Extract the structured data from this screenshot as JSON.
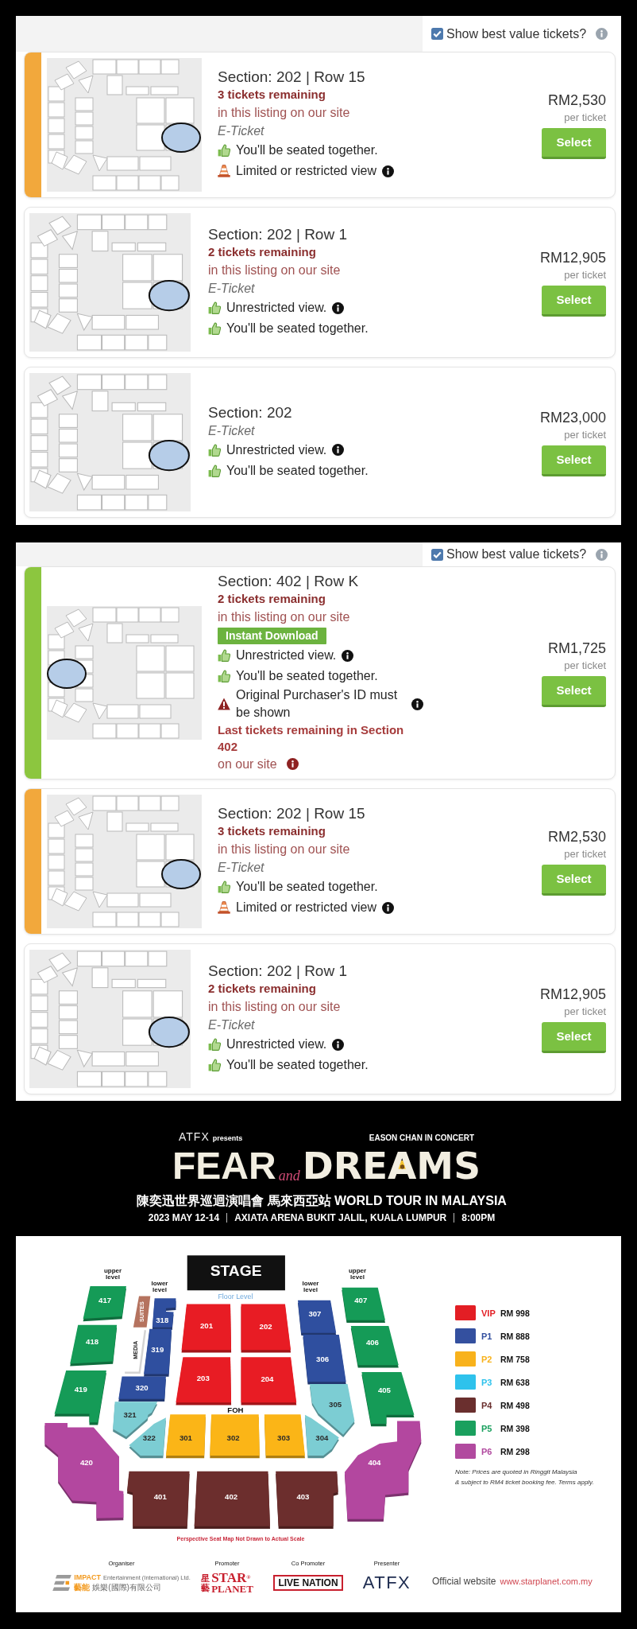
{
  "panels": [
    {
      "filter": {
        "label": "Show best value tickets?",
        "checked": true,
        "info": true
      },
      "listings": [
        {
          "color": "#f2a83c",
          "highlight_left": false,
          "title": "Section: 202 | Row 15",
          "remaining": "3 tickets remaining",
          "availability": "in this listing on our site",
          "delivery": "E-Ticket",
          "features": [
            {
              "kind": "thumb",
              "text": "You'll be seated together.",
              "info": false
            },
            {
              "kind": "cone",
              "text": "Limited or restricted view",
              "info": true
            }
          ],
          "price": "RM2,530",
          "price_unit": "per ticket",
          "button": "Select"
        },
        {
          "highlight_left": false,
          "title": "Section: 202 | Row 1",
          "remaining": "2 tickets remaining",
          "availability": "in this listing on our site",
          "delivery": "E-Ticket",
          "features": [
            {
              "kind": "thumb",
              "text": "Unrestricted view.",
              "info": true
            },
            {
              "kind": "thumb",
              "text": "You'll be seated together.",
              "info": false
            }
          ],
          "price": "RM12,905",
          "price_unit": "per ticket",
          "button": "Select"
        },
        {
          "highlight_left": false,
          "title": "Section: 202",
          "delivery": "E-Ticket",
          "features": [
            {
              "kind": "thumb",
              "text": "Unrestricted view.",
              "info": true
            },
            {
              "kind": "thumb",
              "text": "You'll be seated together.",
              "info": false
            }
          ],
          "price": "RM23,000",
          "price_unit": "per ticket",
          "button": "Select"
        }
      ]
    },
    {
      "filter": {
        "label": "Show best value tickets?",
        "checked": true,
        "info": true
      },
      "listings": [
        {
          "color": "#8cc63f",
          "highlight_left": true,
          "title": "Section: 402 | Row K",
          "remaining": "2 tickets remaining",
          "availability": "in this listing on our site",
          "badge": "Instant Download",
          "features": [
            {
              "kind": "thumb",
              "text": "Unrestricted view.",
              "info": true
            },
            {
              "kind": "thumb",
              "text": "You'll be seated together.",
              "info": false
            },
            {
              "kind": "warning",
              "text": "Original Purchaser's ID must be shown",
              "info": true
            }
          ],
          "notice": {
            "text": "Last tickets remaining in Section 402",
            "detail": "on our site",
            "info": true
          },
          "price": "RM1,725",
          "price_unit": "per ticket",
          "button": "Select"
        },
        {
          "color": "#f2a83c",
          "highlight_left": false,
          "title": "Section: 202 | Row 15",
          "remaining": "3 tickets remaining",
          "availability": "in this listing on our site",
          "delivery": "E-Ticket",
          "features": [
            {
              "kind": "thumb",
              "text": "You'll be seated together.",
              "info": false
            },
            {
              "kind": "cone",
              "text": "Limited or restricted view",
              "info": true
            }
          ],
          "price": "RM2,530",
          "price_unit": "per ticket",
          "button": "Select"
        },
        {
          "highlight_left": false,
          "title": "Section: 202 | Row 1",
          "remaining": "2 tickets remaining",
          "availability": "in this listing on our site",
          "delivery": "E-Ticket",
          "features": [
            {
              "kind": "thumb",
              "text": "Unrestricted view.",
              "info": true
            },
            {
              "kind": "thumb",
              "text": "You'll be seated together.",
              "info": false
            }
          ],
          "price": "RM12,905",
          "price_unit": "per ticket",
          "button": "Select"
        }
      ]
    }
  ],
  "poster": {
    "presenter": "ATFX",
    "presents": "presents",
    "headline": "EASON CHAN IN CONCERT",
    "title": [
      "FEAR",
      "and",
      "DREAMS"
    ],
    "tour": "陳奕迅世界巡迴演唱會 馬來西亞站 WORLD TOUR IN MALAYSIA",
    "details": [
      "2023 MAY 12-14",
      "AXIATA ARENA BUKIT JALIL, KUALA LUMPUR",
      "8:00PM"
    ]
  },
  "seat_map": {
    "stage": "STAGE",
    "floor_label": "Floor Level",
    "foh_label": "FOH",
    "level_labels": [
      "upper level",
      "lower level",
      "lower level",
      "upper level"
    ],
    "suites": {
      "label": "SUITES",
      "color": "#b5735f"
    },
    "media_label": "MEDIA",
    "sections": [
      {
        "label": "417",
        "color": "#159b57"
      },
      {
        "label": "418",
        "color": "#159b57"
      },
      {
        "label": "419",
        "color": "#159b57"
      },
      {
        "label": "420",
        "color": "#b3479f"
      },
      {
        "label": "318",
        "color": "#2f4f9f"
      },
      {
        "label": "319",
        "color": "#2f4f9f"
      },
      {
        "label": "320",
        "color": "#2f4f9f"
      },
      {
        "label": "321",
        "color": "#7ccdd3"
      },
      {
        "label": "322",
        "color": "#7ccdd3"
      },
      {
        "label": "201",
        "color": "#e81c24"
      },
      {
        "label": "202",
        "color": "#e81c24"
      },
      {
        "label": "203",
        "color": "#e81c24"
      },
      {
        "label": "204",
        "color": "#e81c24"
      },
      {
        "label": "301",
        "color": "#fbb517"
      },
      {
        "label": "302",
        "color": "#fbb517"
      },
      {
        "label": "303",
        "color": "#fbb517"
      },
      {
        "label": "307",
        "color": "#2f4f9f"
      },
      {
        "label": "306",
        "color": "#2f4f9f"
      },
      {
        "label": "305",
        "color": "#7ccdd3"
      },
      {
        "label": "304",
        "color": "#7ccdd3"
      },
      {
        "label": "407",
        "color": "#159b57"
      },
      {
        "label": "406",
        "color": "#159b57"
      },
      {
        "label": "405",
        "color": "#159b57"
      },
      {
        "label": "404",
        "color": "#b3479f"
      },
      {
        "label": "401",
        "color": "#6c2e2d"
      },
      {
        "label": "402",
        "color": "#6c2e2d"
      },
      {
        "label": "403",
        "color": "#6c2e2d"
      }
    ],
    "legend": [
      {
        "tier": "VIP",
        "price": "RM 998",
        "color": "#e31e24"
      },
      {
        "tier": "P1",
        "price": "RM 888",
        "color": "#34509f"
      },
      {
        "tier": "P2",
        "price": "RM 758",
        "color": "#f8b21c"
      },
      {
        "tier": "P3",
        "price": "RM 638",
        "color": "#2ec2ec"
      },
      {
        "tier": "P4",
        "price": "RM 498",
        "color": "#6a2f2e"
      },
      {
        "tier": "P5",
        "price": "RM 398",
        "color": "#1aa05e"
      },
      {
        "tier": "P6",
        "price": "RM 298",
        "color": "#b14a9f"
      }
    ],
    "note_lines": [
      "Note: Prices are quoted in Ringgit Malaysia",
      "& subject to RM4 ticket booking fee. Terms apply."
    ],
    "disclaimer": "Perspective Seat Map Not Drawn to Actual Scale"
  },
  "footer": {
    "credits": [
      {
        "role": "Organiser",
        "kind": "emblem",
        "name": "IMPACT",
        "descriptor": "Entertainment (International) Ltd.",
        "name_cjk": "藝能",
        "descriptor_cjk": "娛樂(國際)有限公司"
      },
      {
        "role": "Promoter",
        "kind": "stacked",
        "cjk": "星藝",
        "top": "STAR$^{®}$",
        "bottom": "PLANET"
      },
      {
        "role": "Co Promoter",
        "kind": "boxed",
        "text": "LIVE NATION"
      },
      {
        "role": "Presenter",
        "kind": "plain",
        "text": "ATFX"
      }
    ],
    "website": {
      "label": "Official website",
      "url": "www.starplanet.com.my"
    }
  }
}
